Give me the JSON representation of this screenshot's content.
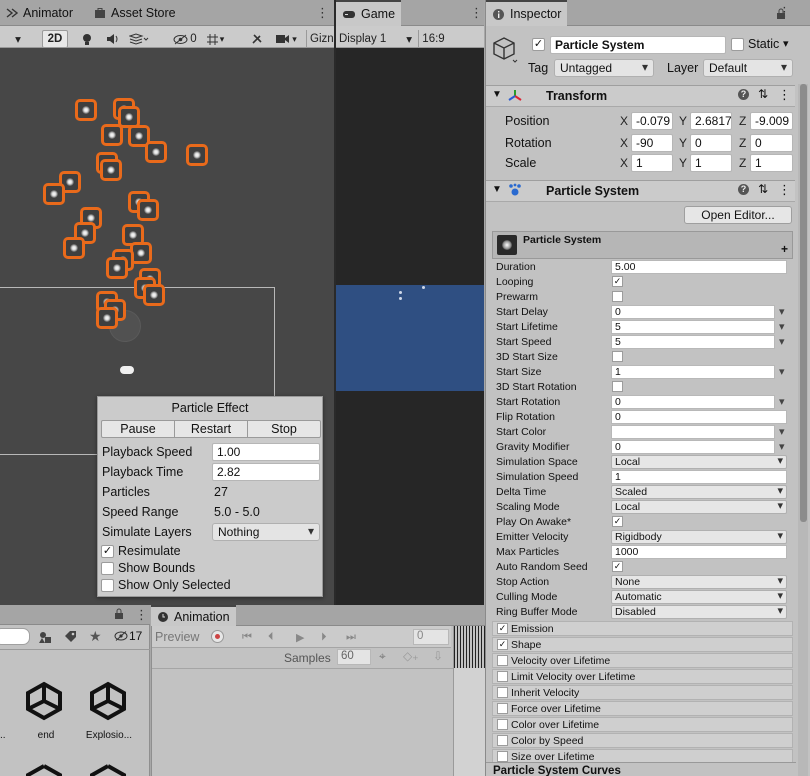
{
  "left_tabs": {
    "animator": "Animator",
    "asset_store": "Asset Store"
  },
  "scene_toolbar": {
    "mode_2d": "2D",
    "gizmos": "Gizn",
    "hidden_count": "0"
  },
  "game": {
    "tab": "Game",
    "display": "Display 1",
    "aspect": "16:9"
  },
  "particle_effect": {
    "title": "Particle Effect",
    "pause": "Pause",
    "restart": "Restart",
    "stop": "Stop",
    "playback_speed_label": "Playback Speed",
    "playback_speed": "1.00",
    "playback_time_label": "Playback Time",
    "playback_time": "2.82",
    "particles_label": "Particles",
    "particles": "27",
    "speed_range_label": "Speed Range",
    "speed_range": "5.0 - 5.0",
    "simulate_layers_label": "Simulate Layers",
    "simulate_layers": "Nothing",
    "resimulate_label": "Resimulate",
    "resimulate": true,
    "show_bounds_label": "Show Bounds",
    "show_only_selected_label": "Show Only Selected"
  },
  "project": {
    "hidden_count": "17",
    "assets": [
      "end",
      "Explosio..."
    ]
  },
  "animation": {
    "tab": "Animation",
    "preview": "Preview",
    "frame": "0",
    "samples_label": "Samples",
    "samples": "60"
  },
  "inspector": {
    "tab": "Inspector",
    "object_name": "Particle System",
    "static_label": "Static",
    "tag_label": "Tag",
    "tag": "Untagged",
    "layer_label": "Layer",
    "layer": "Default",
    "transform": {
      "title": "Transform",
      "position_label": "Position",
      "rotation_label": "Rotation",
      "scale_label": "Scale",
      "position": {
        "x": "-0.079",
        "y": "2.6817",
        "z": "-9.009"
      },
      "rotation": {
        "x": "-90",
        "y": "0",
        "z": "0"
      },
      "scale": {
        "x": "1",
        "y": "1",
        "z": "1"
      }
    },
    "particle_system": {
      "title": "Particle System",
      "open_editor": "Open Editor...",
      "header": "Particle System",
      "rows": [
        {
          "label": "Duration",
          "kind": "field",
          "value": "5.00"
        },
        {
          "label": "Looping",
          "kind": "check",
          "value": "✓"
        },
        {
          "label": "Prewarm",
          "kind": "check",
          "value": ""
        },
        {
          "label": "Start Delay",
          "kind": "field-caret",
          "value": "0"
        },
        {
          "label": "Start Lifetime",
          "kind": "field-caret",
          "value": "5"
        },
        {
          "label": "Start Speed",
          "kind": "field-caret",
          "value": "5"
        },
        {
          "label": "3D Start Size",
          "kind": "check",
          "value": ""
        },
        {
          "label": "Start Size",
          "kind": "field-caret",
          "value": "1"
        },
        {
          "label": "3D Start Rotation",
          "kind": "check",
          "value": ""
        },
        {
          "label": "Start Rotation",
          "kind": "field-caret",
          "value": "0"
        },
        {
          "label": "Flip Rotation",
          "kind": "field",
          "value": "0"
        },
        {
          "label": "Start Color",
          "kind": "color",
          "value": ""
        },
        {
          "label": "Gravity Modifier",
          "kind": "field-caret",
          "value": "0"
        },
        {
          "label": "Simulation Space",
          "kind": "dropdown",
          "value": "Local"
        },
        {
          "label": "Simulation Speed",
          "kind": "field",
          "value": "1"
        },
        {
          "label": "Delta Time",
          "kind": "dropdown",
          "value": "Scaled"
        },
        {
          "label": "Scaling Mode",
          "kind": "dropdown",
          "value": "Local"
        },
        {
          "label": "Play On Awake*",
          "kind": "check",
          "value": "✓"
        },
        {
          "label": "Emitter Velocity",
          "kind": "dropdown",
          "value": "Rigidbody"
        },
        {
          "label": "Max Particles",
          "kind": "field",
          "value": "1000"
        },
        {
          "label": "Auto Random Seed",
          "kind": "check",
          "value": "✓"
        },
        {
          "label": "Stop Action",
          "kind": "dropdown",
          "value": "None"
        },
        {
          "label": "Culling Mode",
          "kind": "dropdown",
          "value": "Automatic"
        },
        {
          "label": "Ring Buffer Mode",
          "kind": "dropdown",
          "value": "Disabled"
        }
      ],
      "modules": [
        {
          "label": "Emission",
          "checked": "✓"
        },
        {
          "label": "Shape",
          "checked": "✓"
        },
        {
          "label": "Velocity over Lifetime",
          "checked": ""
        },
        {
          "label": "Limit Velocity over Lifetime",
          "checked": ""
        },
        {
          "label": "Inherit Velocity",
          "checked": ""
        },
        {
          "label": "Force over Lifetime",
          "checked": ""
        },
        {
          "label": "Color over Lifetime",
          "checked": ""
        },
        {
          "label": "Color by Speed",
          "checked": ""
        },
        {
          "label": "Size over Lifetime",
          "checked": ""
        }
      ],
      "curves_label": "Particle System Curves"
    }
  },
  "colors": {
    "selection_outline": "#e96a1b",
    "game_sky": "#2f4f82",
    "scene_bg": "#474747"
  }
}
